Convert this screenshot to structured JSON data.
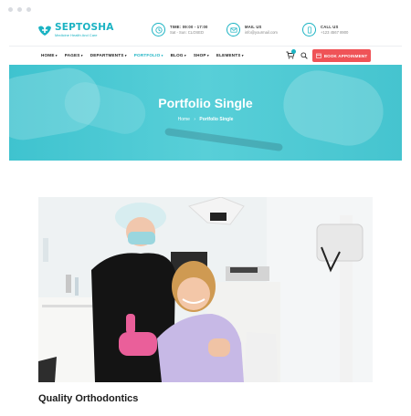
{
  "header": {
    "brand": "SEPTOSHA",
    "tagline": "Medicine Health And Care",
    "time": {
      "title": "TIME: 09:00 - 17:00",
      "detail": "Sat - Sun: CLOSED"
    },
    "mail": {
      "title": "MAIL US",
      "detail": "info@yourmail.com"
    },
    "call": {
      "title": "CALL US",
      "detail": "+123 4567 8900"
    }
  },
  "nav": {
    "items": [
      "HOME",
      "PAGES",
      "DEPARTMENTS",
      "PORTFOLIO",
      "BLOG",
      "SHOP",
      "ELEMENTS"
    ],
    "active": "PORTFOLIO",
    "cart_count": "0",
    "book_label": "BOOK APPOINMENT"
  },
  "hero": {
    "title": "Portfolio Single",
    "crumb_home": "Home",
    "crumb_current": "Portfolio Single"
  },
  "content": {
    "caption": "Quality Orthodontics"
  },
  "colors": {
    "accent": "#1bb3c3",
    "button": "#ef5357",
    "hero": "#4fcad3"
  },
  "icons": [
    "clock-icon",
    "mail-icon",
    "phone-icon",
    "cart-icon",
    "search-icon",
    "calendar-icon",
    "chevron-down-icon"
  ]
}
